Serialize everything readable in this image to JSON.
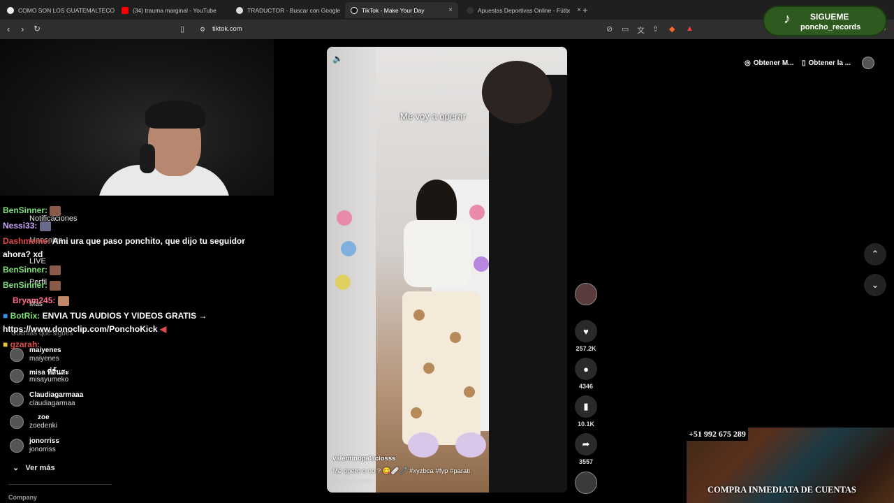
{
  "browser": {
    "tabs": [
      {
        "title": "COMO SON LOS GUATEMALTECOS -",
        "color": "#ffffff"
      },
      {
        "title": "(34) trauma marginal - YouTube",
        "color": "#ff0000"
      },
      {
        "title": "TRADUCTOR - Buscar con Google",
        "color": "#ffffff"
      },
      {
        "title": "TikTok - Make Your Day",
        "color": "#ffffff"
      },
      {
        "title": "Apuestas Deportivas Online - Fútbol",
        "color": "#ffffff"
      }
    ],
    "close_label": "×",
    "new_tab_label": "+",
    "url": "tiktok.com"
  },
  "overlay": {
    "follow_line1": "SIGUEME",
    "follow_line2": "poncho_records"
  },
  "chat": [
    {
      "user": "BenSinner:",
      "user_color": "#7ee07a",
      "text": ""
    },
    {
      "user": "Nessi33:",
      "user_color": "#c9a8ff",
      "text": ""
    },
    {
      "user": "Dashmeme:",
      "user_color": "#e04a4a",
      "text": "Ami ura que paso ponchito, que dijo tu seguidor"
    },
    {
      "user": "",
      "user_color": "#ffffff",
      "text": "ahora? xd"
    },
    {
      "user": "BenSinner:",
      "user_color": "#7ee07a",
      "text": ""
    },
    {
      "user": "BenSinner:",
      "user_color": "#7ee07a",
      "text": ""
    },
    {
      "user": "Bryam245:",
      "user_color": "#ff6a8a",
      "text": ""
    },
    {
      "user": "BotRix:",
      "user_color": "#7ee07a",
      "text": "ENVIA TUS AUDIOS Y VIDEOS GRATIS →"
    },
    {
      "user": "",
      "user_color": "#ffffff",
      "text": "https://www.donoclip.com/PonchoKick"
    },
    {
      "user": "gzarah:",
      "user_color": "#e04a4a",
      "text": ""
    }
  ],
  "tiktok_nav": {
    "notifications": "Notificaciones",
    "messages": "Mensajes",
    "live": "LIVE",
    "profile": "Perfil",
    "more": "Más",
    "following_header": "Cuentas que sigues",
    "following": [
      {
        "name": "maiyenes",
        "user": "maiyenes"
      },
      {
        "name": "misa ที่สิ้นสะ",
        "user": "misayumeko"
      },
      {
        "name": "Claudiagarmaaa",
        "user": "claudiagarmaa"
      },
      {
        "name": "zoe",
        "user": "zoedenki"
      },
      {
        "name": "jonorriss",
        "user": "jonorriss"
      }
    ],
    "see_more": "Ver más",
    "company": "Company"
  },
  "video": {
    "caption": "Me voy a operar",
    "username": "valentinopalaciosss",
    "description": "Me opero o no ? 😋🩹🧷 #xyzbca #fyp #parati",
    "translate": "Ver traducción"
  },
  "actions": {
    "likes": "257.2K",
    "comments": "4346",
    "saves": "10.1K",
    "shares": "3557"
  },
  "top_right": {
    "get_app_1": "Obtener M...",
    "get_app_2": "Obtener la ..."
  },
  "ad": {
    "phone": "+51 992 675 289",
    "text": "COMPRA INMEDIATA DE CUENTAS"
  }
}
